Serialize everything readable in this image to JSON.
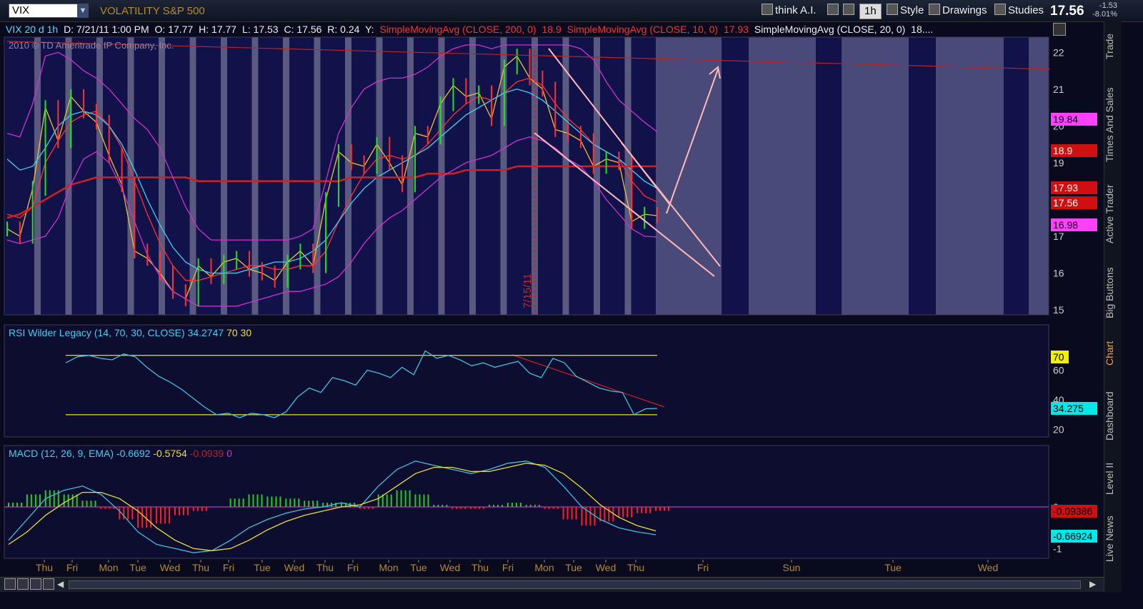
{
  "toolbar": {
    "symbol": "VIX",
    "description": "VOLATILITY S&P 500",
    "think": "think A.I.",
    "timeframe": "1h",
    "style": "Style",
    "drawings": "Drawings",
    "studies": "Studies",
    "last": "17.56",
    "change": "-1.53",
    "change_pct": "-8.01%"
  },
  "info": {
    "label": "VIX 20 d 1h",
    "date": "D: 7/21/11 1:00 PM",
    "open": "O: 17.77",
    "high": "H: 17.77",
    "low": "L: 17.53",
    "close": "C: 17.56",
    "range": "R: 0.24",
    "y": "Y:",
    "sma200": "SimpleMovingAvg (CLOSE, 200, 0)",
    "sma200_val": "18.9",
    "sma10": "SimpleMovingAvg (CLOSE, 10, 0)",
    "sma10_val": "17.93",
    "sma20": "SimpleMovingAvg (CLOSE, 20, 0)",
    "sma20_val": "18...."
  },
  "copyright": "2010 © TD Ameritrade IP Company, Inc.",
  "date_marker": "7/15/11",
  "price_pills": {
    "bb_upper": "19.84",
    "sma200": "18.9",
    "sma10": "17.93",
    "last": "17.56",
    "bb_lower": "16.98"
  },
  "rsi": {
    "title": "RSI Wilder Legacy (14, 70, 30, CLOSE)",
    "value": "34.2747",
    "ob": "70",
    "os": "30",
    "pill_ob": "70",
    "pill_val": "34.275"
  },
  "macd": {
    "title": "MACD (12, 26, 9, EMA)",
    "value": "-0.6692",
    "avg": "-0.5754",
    "diff": "-0.0939",
    "zero": "0",
    "pill_diff": "-0.09386",
    "pill_val": "-0.66924"
  },
  "sidebar": [
    "Trade",
    "Times And Sales",
    "Active Trader",
    "Big Buttons",
    "Chart",
    "Dashboard",
    "Level II",
    "Live News"
  ],
  "colors": {
    "bg": "#0a0a1e",
    "close": "#f0c030",
    "sma10": "#ff3030",
    "sma20": "#40d0f0",
    "sma200": "#d02020",
    "bb": "#d030d0",
    "rsi": "#40c0e0",
    "levels": "#e8e030",
    "trend": "#ffb0b0",
    "macd_pos": "#20d020",
    "macd_neg": "#ff2020"
  },
  "chart_data": [
    {
      "type": "line",
      "title": "VIX 20 d 1h",
      "x": [
        "Thu",
        "Fri",
        "Mon",
        "Tue",
        "Wed",
        "Thu",
        "Fri",
        "Tue",
        "Wed",
        "Thu",
        "Fri",
        "Mon",
        "Tue",
        "Wed",
        "Thu",
        "Fri",
        "Mon",
        "Tue",
        "Wed",
        "Thu",
        "Fri",
        "Sun",
        "Tue",
        "Wed"
      ],
      "ylim": [
        15,
        22.2
      ],
      "yticks": [
        15,
        16,
        17,
        18,
        19,
        20,
        21,
        22
      ],
      "series": [
        {
          "name": "close",
          "values": [
            17.2,
            17.0,
            18.3,
            20.5,
            19.6,
            20.8,
            20.4,
            20.1,
            19.2,
            18.4,
            16.6,
            16.4,
            16.0,
            15.5,
            15.3,
            16.2,
            15.9,
            16.3,
            16.4,
            16.1,
            16.0,
            15.8,
            16.3,
            16.6,
            16.2,
            18.0,
            19.3,
            19.0,
            18.9,
            19.5,
            19.0,
            18.4,
            19.8,
            19.7,
            20.6,
            21.1,
            20.8,
            20.9,
            20.2,
            21.6,
            21.9,
            21.3,
            21.0,
            19.9,
            19.8,
            19.6,
            18.9,
            19.1,
            19.0,
            17.4,
            17.6,
            17.56
          ]
        },
        {
          "name": "SimpleMovingAvg (CLOSE, 10, 0)",
          "values": [
            17.6,
            17.5,
            17.8,
            19.0,
            19.6,
            20.1,
            20.3,
            20.4,
            20.0,
            19.4,
            18.5,
            17.6,
            16.8,
            16.2,
            15.8,
            15.8,
            15.9,
            16.0,
            16.1,
            16.2,
            16.2,
            16.1,
            16.1,
            16.2,
            16.2,
            16.6,
            17.4,
            18.1,
            18.7,
            19.1,
            19.2,
            19.1,
            19.2,
            19.5,
            19.9,
            20.3,
            20.6,
            20.8,
            20.7,
            20.9,
            21.2,
            21.3,
            21.1,
            20.6,
            20.2,
            19.9,
            19.5,
            19.3,
            19.1,
            18.5,
            18.1,
            17.93
          ]
        },
        {
          "name": "SimpleMovingAvg (CLOSE, 20, 0)",
          "values": [
            19.1,
            18.8,
            18.9,
            19.4,
            20.0,
            20.3,
            20.4,
            20.3,
            20.0,
            19.5,
            18.8,
            18.0,
            17.3,
            16.7,
            16.3,
            16.1,
            16.0,
            16.0,
            16.0,
            16.1,
            16.2,
            16.3,
            16.3,
            16.4,
            16.6,
            16.9,
            17.4,
            17.9,
            18.3,
            18.6,
            18.8,
            19.0,
            19.2,
            19.4,
            19.7,
            20.0,
            20.3,
            20.5,
            20.7,
            20.9,
            21.0,
            20.9,
            20.7,
            20.4,
            20.1,
            19.8,
            19.5,
            19.3,
            19.1,
            18.8,
            18.5,
            18.3
          ]
        },
        {
          "name": "SimpleMovingAvg (CLOSE, 200, 0)",
          "values": [
            17.5,
            17.6,
            17.8,
            18.0,
            18.2,
            18.4,
            18.5,
            18.6,
            18.6,
            18.6,
            18.6,
            18.6,
            18.6,
            18.6,
            18.6,
            18.5,
            18.5,
            18.5,
            18.5,
            18.5,
            18.5,
            18.5,
            18.5,
            18.5,
            18.5,
            18.5,
            18.5,
            18.6,
            18.6,
            18.6,
            18.6,
            18.6,
            18.6,
            18.7,
            18.7,
            18.7,
            18.8,
            18.8,
            18.8,
            18.8,
            18.9,
            18.9,
            18.9,
            18.9,
            18.9,
            18.9,
            18.9,
            18.9,
            18.9,
            18.9,
            18.9,
            18.9
          ]
        },
        {
          "name": "bb_upper",
          "values": [
            19.8,
            19.7,
            20.6,
            21.9,
            22.0,
            21.8,
            21.5,
            21.3,
            21.0,
            20.6,
            20.2,
            19.9,
            19.4,
            18.6,
            17.8,
            17.2,
            16.9,
            16.9,
            16.9,
            16.9,
            16.9,
            16.9,
            16.9,
            17.0,
            17.2,
            18.5,
            19.8,
            20.5,
            21.0,
            21.2,
            21.3,
            21.3,
            21.4,
            21.6,
            21.9,
            22.1,
            22.2,
            22.2,
            22.1,
            22.2,
            22.2,
            22.2,
            22.2,
            22.2,
            22.2,
            22.1,
            21.8,
            21.2,
            20.7,
            20.4,
            20.1,
            19.84
          ]
        },
        {
          "name": "bb_lower",
          "values": [
            16.9,
            16.8,
            16.9,
            17.0,
            17.5,
            18.4,
            19.1,
            19.3,
            19.0,
            18.3,
            17.4,
            16.5,
            15.9,
            15.5,
            15.3,
            15.1,
            15.1,
            15.1,
            15.1,
            15.2,
            15.3,
            15.4,
            15.5,
            15.5,
            15.6,
            15.7,
            15.9,
            16.3,
            16.8,
            17.2,
            17.5,
            17.7,
            18.0,
            18.3,
            18.6,
            18.8,
            19.0,
            19.1,
            19.2,
            19.4,
            19.6,
            19.7,
            19.6,
            19.4,
            19.1,
            18.9,
            18.5,
            18.0,
            17.6,
            17.2,
            17.0,
            16.98
          ]
        }
      ]
    },
    {
      "type": "line",
      "title": "RSI Wilder Legacy (14, 70, 30, CLOSE)",
      "ylim": [
        15,
        80
      ],
      "yticks": [
        20,
        40,
        60
      ],
      "series": [
        {
          "name": "RSI",
          "values": [
            65,
            69,
            70,
            68,
            67,
            71,
            69,
            62,
            56,
            52,
            47,
            41,
            35,
            30,
            31,
            28,
            31,
            30,
            28,
            32,
            42,
            48,
            45,
            55,
            53,
            50,
            60,
            58,
            55,
            62,
            57,
            73,
            68,
            70,
            67,
            63,
            65,
            62,
            64,
            66,
            58,
            55,
            68,
            65,
            56,
            52,
            48,
            46,
            45,
            30,
            34,
            34.27
          ]
        },
        {
          "name": "overbought",
          "values": [
            70
          ]
        },
        {
          "name": "oversold",
          "values": [
            30
          ]
        }
      ]
    },
    {
      "type": "bar",
      "title": "MACD (12, 26, 9, EMA)",
      "ylim": [
        -1.2,
        1.2
      ],
      "yticks": [
        0,
        -1
      ],
      "series": [
        {
          "name": "Value",
          "values": [
            -0.8,
            -0.3,
            0.2,
            0.4,
            0.5,
            0.3,
            -0.1,
            -0.6,
            -0.9,
            -1.0,
            -1.1,
            -1.05,
            -0.8,
            -0.5,
            -0.3,
            -0.15,
            -0.05,
            0.0,
            0.1,
            0.0,
            0.5,
            0.9,
            1.1,
            1.0,
            0.9,
            0.8,
            0.9,
            1.05,
            1.1,
            0.95,
            0.5,
            0.0,
            -0.3,
            -0.5,
            -0.6,
            -0.6692
          ]
        },
        {
          "name": "Avg",
          "values": [
            -0.9,
            -0.6,
            -0.2,
            0.1,
            0.35,
            0.35,
            0.2,
            -0.1,
            -0.5,
            -0.8,
            -1.0,
            -1.05,
            -1.0,
            -0.8,
            -0.55,
            -0.35,
            -0.2,
            -0.1,
            0.0,
            0.05,
            0.2,
            0.5,
            0.8,
            0.95,
            0.95,
            0.85,
            0.85,
            0.95,
            1.05,
            1.0,
            0.8,
            0.45,
            0.05,
            -0.25,
            -0.45,
            -0.5754
          ]
        },
        {
          "name": "Diff",
          "values": [
            0.1,
            0.3,
            0.4,
            0.3,
            0.15,
            -0.05,
            -0.3,
            -0.5,
            -0.4,
            -0.2,
            -0.1,
            0.0,
            0.2,
            0.3,
            0.25,
            0.2,
            0.15,
            0.1,
            0.1,
            -0.05,
            0.3,
            0.4,
            0.3,
            0.05,
            -0.05,
            -0.05,
            0.05,
            0.1,
            0.05,
            -0.05,
            -0.3,
            -0.45,
            -0.35,
            -0.25,
            -0.15,
            -0.0939
          ]
        }
      ]
    }
  ]
}
